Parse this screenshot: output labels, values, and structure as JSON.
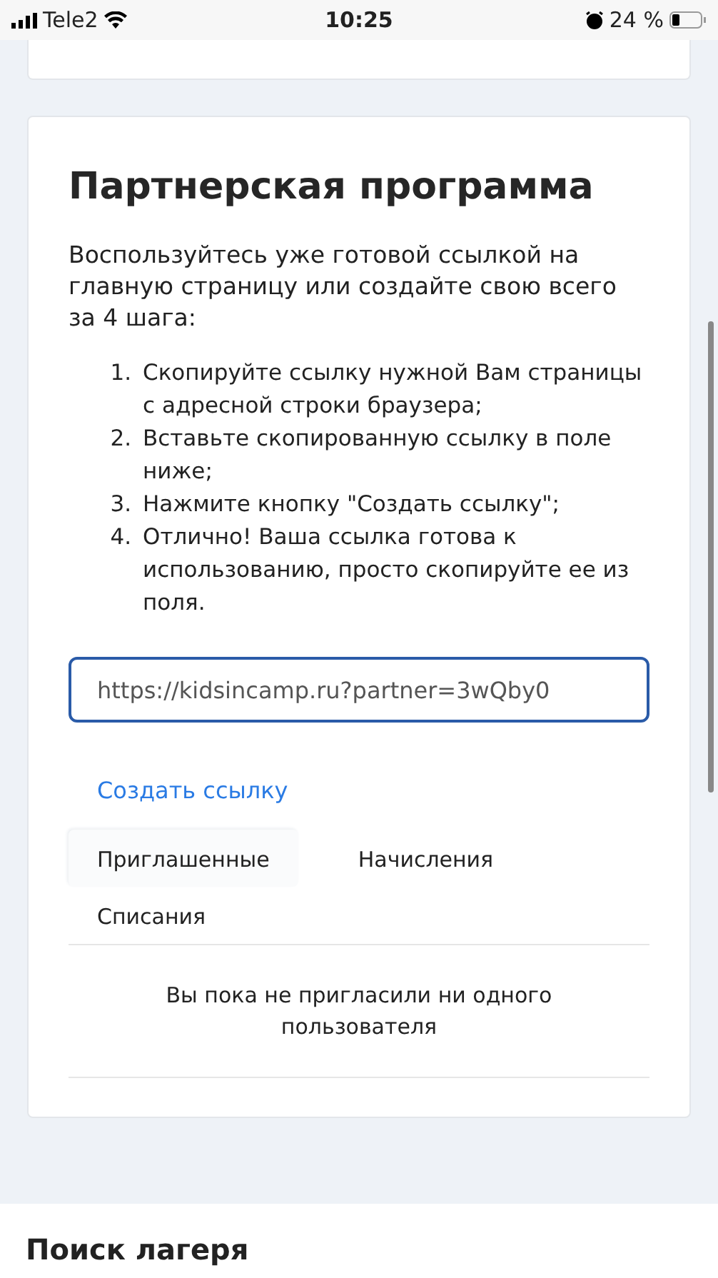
{
  "status_bar": {
    "carrier": "Tele2",
    "time": "10:25",
    "battery_percent": "24 %"
  },
  "partner_card": {
    "title": "Партнерская программа",
    "intro": "Воспользуйтесь уже готовой ссылкой на главную страницу или создайте свою всего за 4 шага:",
    "steps": [
      {
        "number": "1.",
        "text": "Скопируйте ссылку нужной Вам страницы с адресной строки браузера;"
      },
      {
        "number": "2.",
        "text": "Вставьте скопированную ссылку в поле ниже;"
      },
      {
        "number": "3.",
        "text": "Нажмите кнопку \"Создать ссылку\";"
      },
      {
        "number": "4.",
        "text": "Отлично! Ваша ссылка готова к использованию, просто скопируйте ее из поля."
      }
    ],
    "link_field": {
      "value": "https://kidsincamp.ru?partner=3wQby0"
    },
    "create_button": "Создать ссылку",
    "tabs": [
      {
        "label": "Приглашенные",
        "selected": true
      },
      {
        "label": "Начисления",
        "selected": false
      },
      {
        "label": "Списания",
        "selected": false
      }
    ],
    "empty_message": "Вы пока не пригласили ни одного пользователя"
  },
  "next_section": {
    "title": "Поиск лагеря"
  }
}
